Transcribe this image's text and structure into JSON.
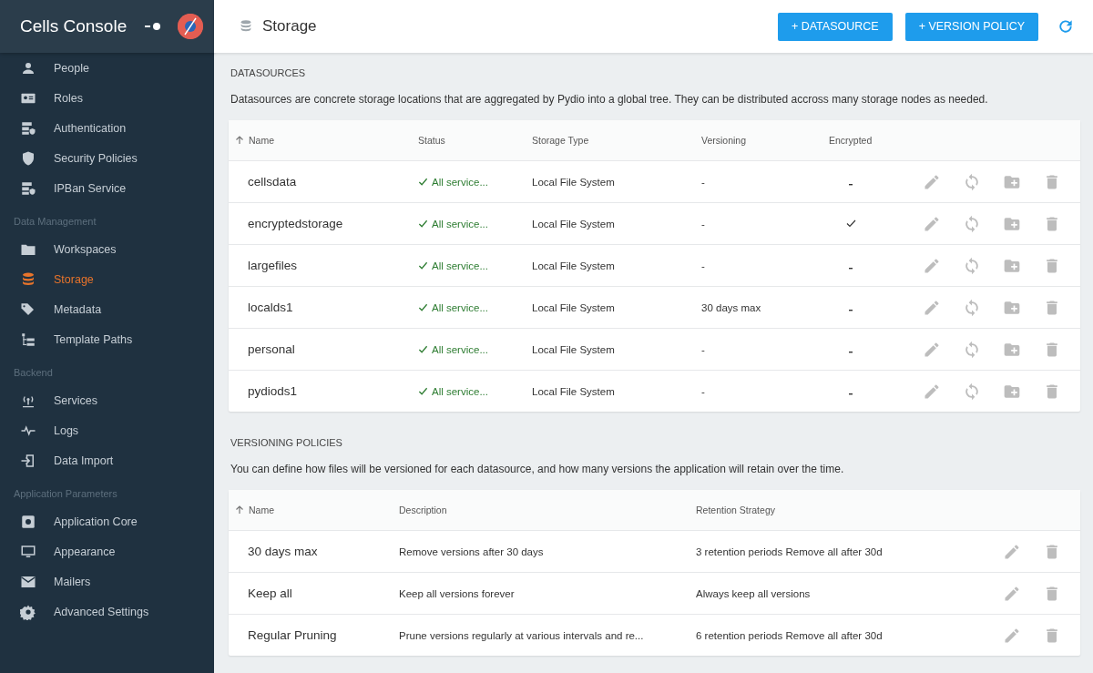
{
  "sidebar": {
    "title": "Cells Console",
    "sections": [
      {
        "items": [
          {
            "label": "People",
            "selected": false
          },
          {
            "label": "Roles",
            "selected": false
          },
          {
            "label": "Authentication",
            "selected": false
          },
          {
            "label": "Security Policies",
            "selected": false
          },
          {
            "label": "IPBan Service",
            "selected": false
          }
        ]
      },
      {
        "heading": "Data Management",
        "items": [
          {
            "label": "Workspaces",
            "selected": false
          },
          {
            "label": "Storage",
            "selected": true
          },
          {
            "label": "Metadata",
            "selected": false
          },
          {
            "label": "Template Paths",
            "selected": false
          }
        ]
      },
      {
        "heading": "Backend",
        "items": [
          {
            "label": "Services",
            "selected": false
          },
          {
            "label": "Logs",
            "selected": false
          },
          {
            "label": "Data Import",
            "selected": false
          }
        ]
      },
      {
        "heading": "Application Parameters",
        "items": [
          {
            "label": "Application Core",
            "selected": false
          },
          {
            "label": "Appearance",
            "selected": false
          },
          {
            "label": "Mailers",
            "selected": false
          },
          {
            "label": "Advanced Settings",
            "selected": false
          }
        ]
      }
    ]
  },
  "page": {
    "title": "Storage",
    "buttons": [
      "+ DATASOURCE",
      "+ VERSION POLICY"
    ]
  },
  "datasources": {
    "heading": "DATASOURCES",
    "description": "Datasources are concrete storage locations that are aggregated by Pydio into a global tree. They can be distributed accross many storage nodes as needed.",
    "columns": [
      "Name",
      "Status",
      "Storage Type",
      "Versioning",
      "Encrypted"
    ],
    "rows": [
      {
        "name": "cellsdata",
        "status": "All service...",
        "storage_type": "Local File System",
        "versioning": "-",
        "encrypted": false
      },
      {
        "name": "encryptedstorage",
        "status": "All service...",
        "storage_type": "Local File System",
        "versioning": "-",
        "encrypted": true
      },
      {
        "name": "largefiles",
        "status": "All service...",
        "storage_type": "Local File System",
        "versioning": "-",
        "encrypted": false
      },
      {
        "name": "localds1",
        "status": "All service...",
        "storage_type": "Local File System",
        "versioning": "30 days max",
        "encrypted": false
      },
      {
        "name": "personal",
        "status": "All service...",
        "storage_type": "Local File System",
        "versioning": "-",
        "encrypted": false
      },
      {
        "name": "pydiods1",
        "status": "All service...",
        "storage_type": "Local File System",
        "versioning": "-",
        "encrypted": false
      }
    ]
  },
  "versioning_policies": {
    "heading": "VERSIONING POLICIES",
    "description": "You can define how files will be versioned for each datasource, and how many versions the application will retain over the time.",
    "columns": [
      "Name",
      "Description",
      "Retention Strategy"
    ],
    "rows": [
      {
        "name": "30 days max",
        "description": "Remove versions after 30 days",
        "retention": "3 retention periods Remove all after 30d"
      },
      {
        "name": "Keep all",
        "description": "Keep all versions forever",
        "retention": "Always keep all versions"
      },
      {
        "name": "Regular Pruning",
        "description": "Prune versions regularly at various intervals and re...",
        "retention": "6 retention periods Remove all after 30d"
      }
    ]
  }
}
